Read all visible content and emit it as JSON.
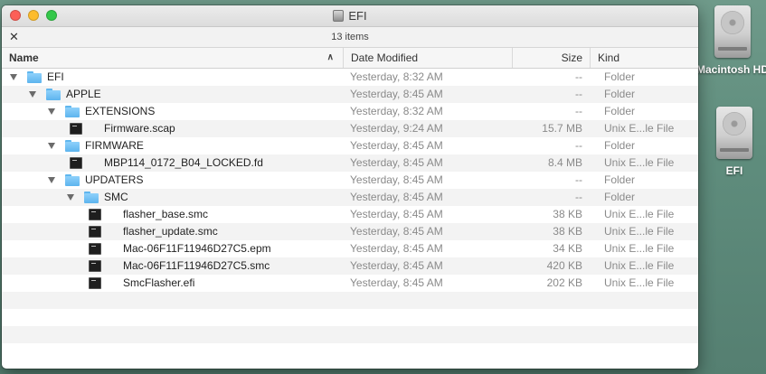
{
  "window": {
    "title": "EFI",
    "item_count": "13 items"
  },
  "columns": {
    "name": "Name",
    "date": "Date Modified",
    "size": "Size",
    "kind": "Kind"
  },
  "rows": [
    {
      "name": "EFI",
      "date": "Yesterday, 8:32 AM",
      "size": "--",
      "kind": "Folder",
      "type": "folder",
      "depth": 0,
      "expanded": true
    },
    {
      "name": "APPLE",
      "date": "Yesterday, 8:45 AM",
      "size": "--",
      "kind": "Folder",
      "type": "folder",
      "depth": 1,
      "expanded": true
    },
    {
      "name": "EXTENSIONS",
      "date": "Yesterday, 8:32 AM",
      "size": "--",
      "kind": "Folder",
      "type": "folder",
      "depth": 2,
      "expanded": true
    },
    {
      "name": "Firmware.scap",
      "date": "Yesterday, 9:24 AM",
      "size": "15.7 MB",
      "kind": "Unix E...le File",
      "type": "file",
      "depth": 3,
      "expanded": false
    },
    {
      "name": "FIRMWARE",
      "date": "Yesterday, 8:45 AM",
      "size": "--",
      "kind": "Folder",
      "type": "folder",
      "depth": 2,
      "expanded": true
    },
    {
      "name": "MBP114_0172_B04_LOCKED.fd",
      "date": "Yesterday, 8:45 AM",
      "size": "8.4 MB",
      "kind": "Unix E...le File",
      "type": "file",
      "depth": 3,
      "expanded": false
    },
    {
      "name": "UPDATERS",
      "date": "Yesterday, 8:45 AM",
      "size": "--",
      "kind": "Folder",
      "type": "folder",
      "depth": 2,
      "expanded": true
    },
    {
      "name": "SMC",
      "date": "Yesterday, 8:45 AM",
      "size": "--",
      "kind": "Folder",
      "type": "folder",
      "depth": 3,
      "expanded": true
    },
    {
      "name": "flasher_base.smc",
      "date": "Yesterday, 8:45 AM",
      "size": "38 KB",
      "kind": "Unix E...le File",
      "type": "file",
      "depth": 4,
      "expanded": false
    },
    {
      "name": "flasher_update.smc",
      "date": "Yesterday, 8:45 AM",
      "size": "38 KB",
      "kind": "Unix E...le File",
      "type": "file",
      "depth": 4,
      "expanded": false
    },
    {
      "name": "Mac-06F11F11946D27C5.epm",
      "date": "Yesterday, 8:45 AM",
      "size": "34 KB",
      "kind": "Unix E...le File",
      "type": "file",
      "depth": 4,
      "expanded": false
    },
    {
      "name": "Mac-06F11F11946D27C5.smc",
      "date": "Yesterday, 8:45 AM",
      "size": "420 KB",
      "kind": "Unix E...le File",
      "type": "file",
      "depth": 4,
      "expanded": false
    },
    {
      "name": "SmcFlasher.efi",
      "date": "Yesterday, 8:45 AM",
      "size": "202 KB",
      "kind": "Unix E...le File",
      "type": "file",
      "depth": 4,
      "expanded": false
    }
  ],
  "desktop_icons": [
    {
      "label": "Macintosh HD",
      "icon": "hard-drive-icon"
    },
    {
      "label": "EFI",
      "icon": "hard-drive-icon"
    }
  ]
}
